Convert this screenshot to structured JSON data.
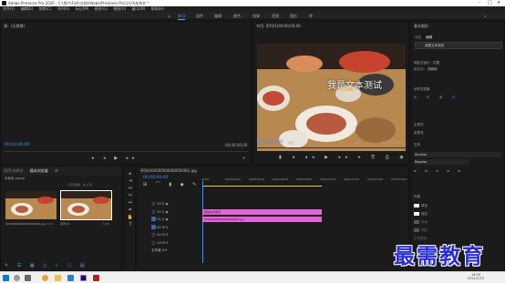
{
  "window": {
    "title": "Adobe Premiere Pro 2020 - C:\\用户\\Fish\\文档\\Adobe\\Premiere Pro\\14.0\\未命名 *"
  },
  "menu": [
    "文件(F)",
    "编辑(E)",
    "剪辑(C)",
    "序列(S)",
    "标记(M)",
    "图形(G)",
    "视图(V)",
    "窗口(W)",
    "帮助(H)"
  ],
  "workspaces": [
    "学习",
    "组件",
    "编辑",
    "颜色",
    "效果",
    "音频",
    "图形",
    "库"
  ],
  "source_panel": {
    "title": "源：(无剪辑)",
    "timecode_left": "00;00;00;00",
    "timecode_right": "00;00;00;00"
  },
  "program_panel": {
    "title": "节目: 序列(1)00;00;00;00",
    "overlay_text": "我是文本测试",
    "timecode": "00;00;00;00",
    "fit": "适合",
    "scale": "1/2",
    "duration": "00;00;05;00"
  },
  "project_panel": {
    "tabs": [
      "项目:未命名",
      "媒体浏览器",
      "库"
    ],
    "file": "未命名.prproj",
    "item_count": "1 项已选择，共 2 项",
    "items": [
      {
        "name": "00000000000000000000.jpg",
        "dur": "5;00"
      },
      {
        "name": "序列 01",
        "dur": "5;00"
      }
    ]
  },
  "timeline": {
    "title": "序列(00000000000000000).jpg",
    "timecode": "00;00;00;00",
    "ruler": [
      "00;00",
      "00;00;02;00",
      "00;00;04;00",
      "00;00;06;00",
      "00;00;08;00",
      "00;00;10;00",
      "00;00;12;00",
      "00;00;14;00",
      "00;00;16;00"
    ],
    "tracks": [
      "V3",
      "V2",
      "V1",
      "A1",
      "A2",
      "A3"
    ],
    "master": "主声道",
    "master_val": "0.0",
    "clips": [
      {
        "label": "我是文本测试",
        "track": "V2"
      },
      {
        "label": "00000000000000000000.jpg",
        "track": "V1"
      }
    ]
  },
  "essential_graphics": {
    "title": "基本图形",
    "tabs": [
      "浏览",
      "编辑"
    ],
    "layer": "我是文本测试",
    "sections": [
      "响应式设计 - 位置",
      "对齐并变换",
      "主样式",
      "文本",
      "外观"
    ],
    "font": "SimSun",
    "style": "Regular",
    "pin": "固定到：",
    "pin_value": "视频帧",
    "master_style": "无样式",
    "appearance": [
      "填充",
      "描边",
      "背景",
      "阴影",
      "文本蒙版"
    ]
  },
  "clock": {
    "time": "14:20",
    "date": "2021/7/12"
  },
  "watermark": "最需教育"
}
